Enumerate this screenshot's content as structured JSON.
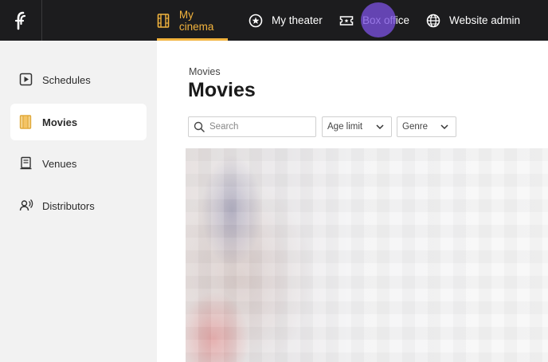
{
  "topbar": {
    "nav": [
      {
        "label": "My cinema",
        "icon": "film-icon",
        "active": true
      },
      {
        "label": "My theater",
        "icon": "star-circle-icon",
        "active": false
      },
      {
        "label": "Box office",
        "icon": "ticket-icon",
        "active": false
      },
      {
        "label": "Website admin",
        "icon": "globe-icon",
        "active": false
      }
    ]
  },
  "sidebar": {
    "items": [
      {
        "label": "Schedules",
        "icon": "play-square-icon",
        "active": false
      },
      {
        "label": "Movies",
        "icon": "film-icon",
        "active": true
      },
      {
        "label": "Venues",
        "icon": "building-icon",
        "active": false
      },
      {
        "label": "Distributors",
        "icon": "user-broadcast-icon",
        "active": false
      }
    ]
  },
  "main": {
    "breadcrumb": "Movies",
    "title": "Movies",
    "search": {
      "placeholder": "Search",
      "value": ""
    },
    "filters": [
      {
        "label": "Age limit"
      },
      {
        "label": "Genre"
      }
    ]
  },
  "colors": {
    "topbar_bg": "#1c1c1e",
    "accent": "#f2b33d",
    "click_marker": "#7850dc"
  }
}
